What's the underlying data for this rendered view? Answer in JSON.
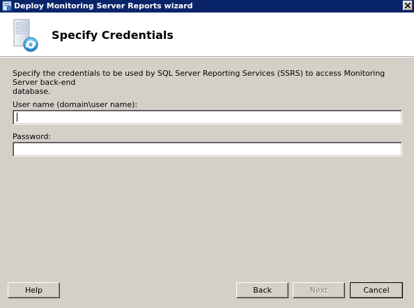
{
  "window": {
    "title": "Deploy Monitoring Server Reports wizard"
  },
  "header": {
    "title": "Specify Credentials"
  },
  "content": {
    "description": "Specify the credentials to be used by SQL Server Reporting Services (SSRS) to access Monitoring Server back-end\ndatabase.",
    "username_label": "User name (domain\\user name):",
    "username_value": "",
    "password_label": "Password:",
    "password_value": ""
  },
  "buttons": {
    "help": "Help",
    "back": "Back",
    "next": "Next",
    "cancel": "Cancel"
  },
  "icons": {
    "app": "wizard-app-icon",
    "header": "server-refresh-icon",
    "close": "close-icon"
  },
  "colors": {
    "titlebar": "#0a246a",
    "dialog_bg": "#d4d0c8",
    "header_bg": "#ffffff"
  }
}
